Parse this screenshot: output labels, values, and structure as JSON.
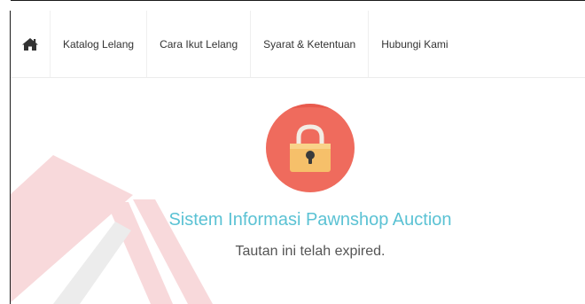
{
  "navbar": {
    "home_icon": "home-icon",
    "items": [
      {
        "label": "Katalog Lelang"
      },
      {
        "label": "Cara Ikut Lelang"
      },
      {
        "label": "Syarat & Ketentuan"
      },
      {
        "label": "Hubungi Kami"
      }
    ]
  },
  "main": {
    "icon": "lock-icon",
    "title": "Sistem Informasi Pawnshop Auction",
    "message": "Tautan ini telah expired."
  },
  "colors": {
    "accent_title": "#5bc2d4",
    "lock_circle": "#ef6b5d",
    "lock_body": "#f6c06a",
    "watermark": "#d9333f"
  }
}
